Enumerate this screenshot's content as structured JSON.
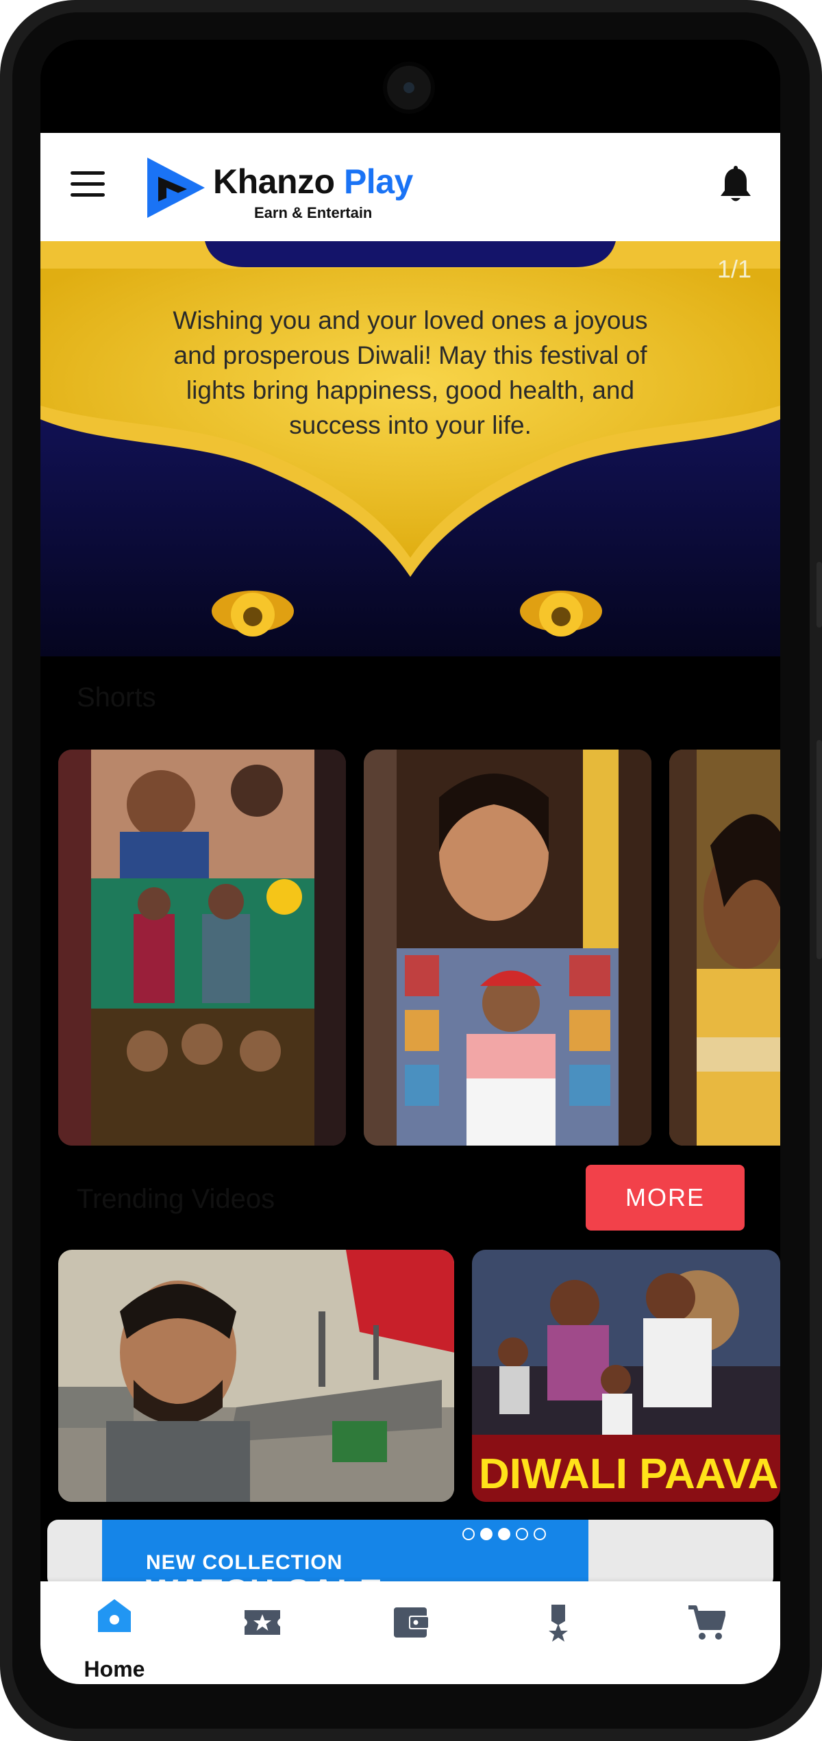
{
  "app": {
    "brand_name_part1": "Khanzo",
    "brand_name_part2": "Play",
    "tagline": "Earn & Entertain"
  },
  "banner": {
    "counter": "1/1",
    "message": "Wishing you and your loved ones a joyous and prosperous Diwali! May this festival of lights bring happiness, good health, and success into your life."
  },
  "shorts": {
    "title": "Shorts"
  },
  "trending": {
    "title": "Trending Videos",
    "more_label": "MORE",
    "card2_caption": "DIWALI PAAVANG"
  },
  "promo": {
    "title": "NEW COLLECTION",
    "subtitle": "WATCH SALE",
    "active_dot": 3,
    "dot_count": 5
  },
  "bottom_nav": {
    "home_label": "Home"
  },
  "colors": {
    "brand_blue": "#1a73f5",
    "more_button": "#f2414a",
    "nav_active": "#2196f3",
    "nav_inactive": "#4a5566"
  },
  "icons": [
    "menu-icon",
    "bell-icon",
    "home-icon",
    "ticket-icon",
    "wallet-icon",
    "medal-icon",
    "cart-icon"
  ]
}
